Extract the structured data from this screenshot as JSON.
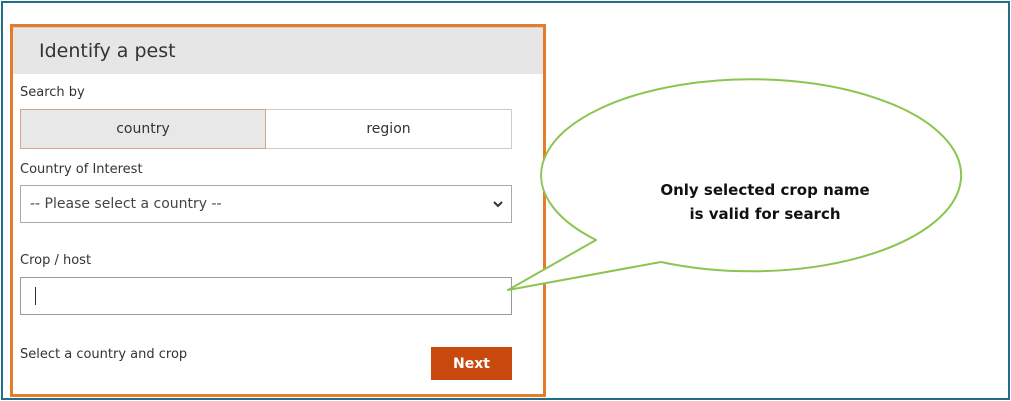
{
  "panel": {
    "title": "Identify a pest",
    "search_by_label": "Search by",
    "search_options": [
      {
        "label": "country",
        "selected": true
      },
      {
        "label": "region",
        "selected": false
      }
    ],
    "country_label": "Country of Interest",
    "country_select": {
      "value": "-- Please select a country --"
    },
    "crop_label": "Crop / host",
    "crop_input": {
      "value": ""
    },
    "hint": "Select a country and crop",
    "next_label": "Next"
  },
  "callout": {
    "lines": [
      "Only selected crop name",
      "is valid for search"
    ]
  },
  "colors": {
    "panel_border": "#e57c2a",
    "next_button": "#c8480e",
    "callout_fill": "#ffffff",
    "callout_stroke": "#8dc450",
    "frame_border": "#1f6f8b"
  }
}
